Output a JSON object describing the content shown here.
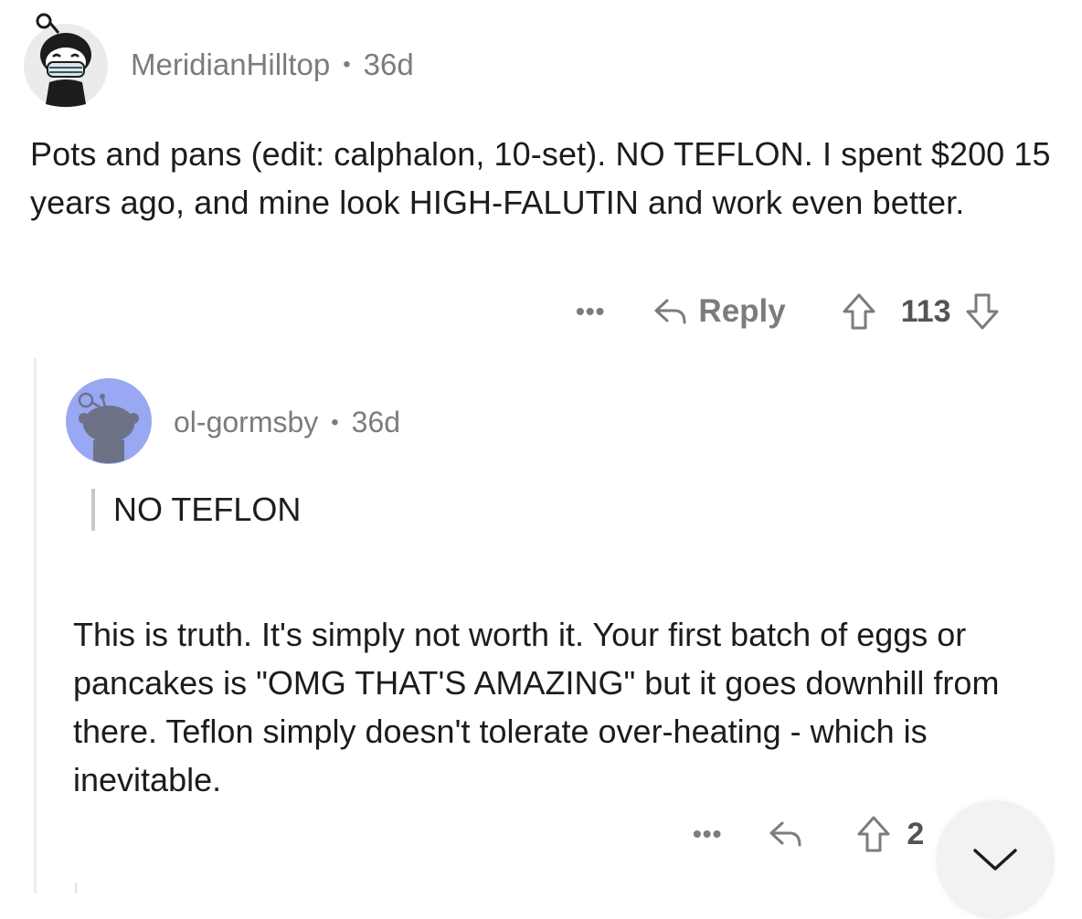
{
  "comment": {
    "username": "MeridianHilltop",
    "separator": "•",
    "age": "36d",
    "body": "Pots and pans (edit: calphalon, 10-set). NO TEFLON. I spent $200 15 years ago, and mine look HIGH-FALUTIN and work even better.",
    "actions": {
      "more": "•••",
      "reply_label": "Reply",
      "score": "113"
    }
  },
  "reply": {
    "username": "ol-gormsby",
    "separator": "•",
    "age": "36d",
    "quote": "NO TEFLON",
    "body": "This is truth. It's simply not worth it. Your first batch of eggs or pancakes is \"OMG THAT'S AMAZING\" but it goes downhill from there. Teflon simply doesn't tolerate over-heating - which is inevitable.",
    "actions": {
      "more": "•••",
      "score": "2"
    }
  },
  "icons": {
    "avatar1": "masked-snoo-avatar-icon",
    "avatar2": "default-snoo-avatar-icon",
    "reply": "reply-arrow-icon",
    "upvote": "upvote-arrow-icon",
    "downvote": "downvote-arrow-icon",
    "collapse": "chevron-down-icon"
  },
  "colors": {
    "meta_text": "#7c7c7c",
    "body_text": "#1c1c1c",
    "avatar2_bg": "#98a8f2",
    "thread_line": "#ececec",
    "collapse_bg": "#f2f2f2"
  }
}
